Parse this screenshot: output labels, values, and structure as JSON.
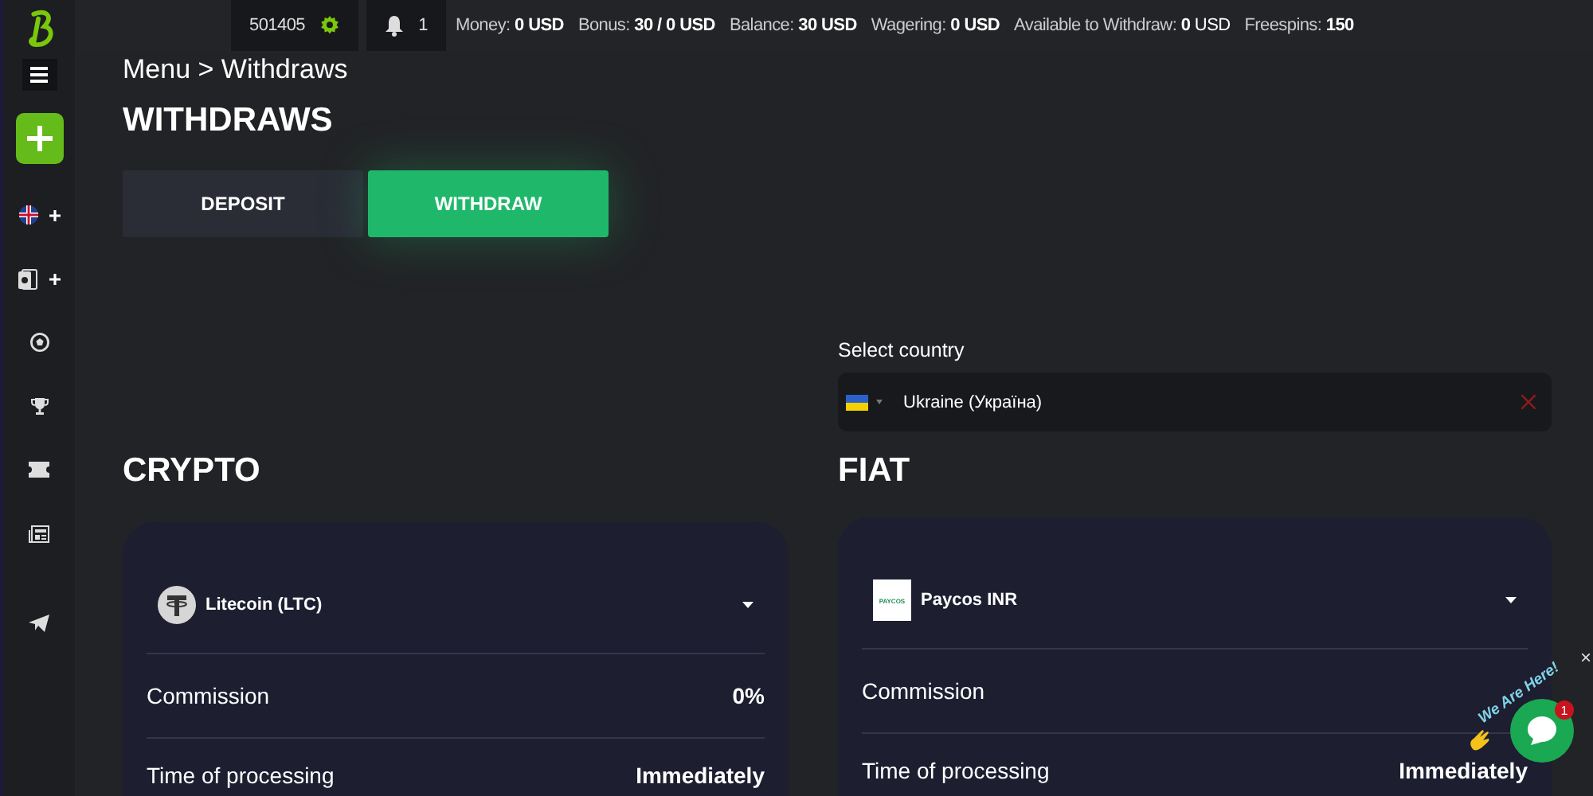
{
  "topbar": {
    "user_id": "501405",
    "notifications": "1",
    "stats": [
      {
        "label": "Money:",
        "value": "0 USD"
      },
      {
        "label": "Bonus:",
        "value": "30 / 0 USD"
      },
      {
        "label": "Balance:",
        "value": "30 USD"
      },
      {
        "label": "Wagering:",
        "value": "0 USD"
      },
      {
        "label": "Available to Withdraw:",
        "value": "**0** USD"
      },
      {
        "label": "Freespins:",
        "value": "150"
      }
    ]
  },
  "sidebar": {
    "items": [
      {
        "kind": "language",
        "expandable": true
      },
      {
        "kind": "cards",
        "expandable": true
      },
      {
        "kind": "soccer",
        "expandable": false
      },
      {
        "kind": "trophy",
        "expandable": false
      },
      {
        "kind": "ticket",
        "expandable": false
      },
      {
        "kind": "news",
        "expandable": false
      },
      {
        "kind": "telegram",
        "expandable": false
      }
    ]
  },
  "breadcrumb": "Menu > Withdraws",
  "title": "WITHDRAWS",
  "tabs": [
    {
      "label": "DEPOSIT",
      "selected": false
    },
    {
      "label": "WITHDRAW",
      "selected": true
    }
  ],
  "crypto": {
    "title": "CRYPTO",
    "method": {
      "kind": "coin",
      "name": "Litecoin (LTC)"
    },
    "rows": [
      {
        "label": "Commission",
        "value": "0%"
      },
      {
        "label": "Time of processing",
        "value": "Immediately"
      }
    ]
  },
  "fiat": {
    "select_label": "Select country",
    "country": "Ukraine (Україна)",
    "title": "FIAT",
    "method": {
      "kind": "logo",
      "logo_text": "PAYCOS",
      "name": "Paycos INR"
    },
    "rows": [
      {
        "label": "Commission"
      },
      {
        "label": "Time of processing",
        "value": "Immediately"
      }
    ]
  },
  "chat": {
    "text": "We Are Here!",
    "badge": "1",
    "close": "×"
  }
}
